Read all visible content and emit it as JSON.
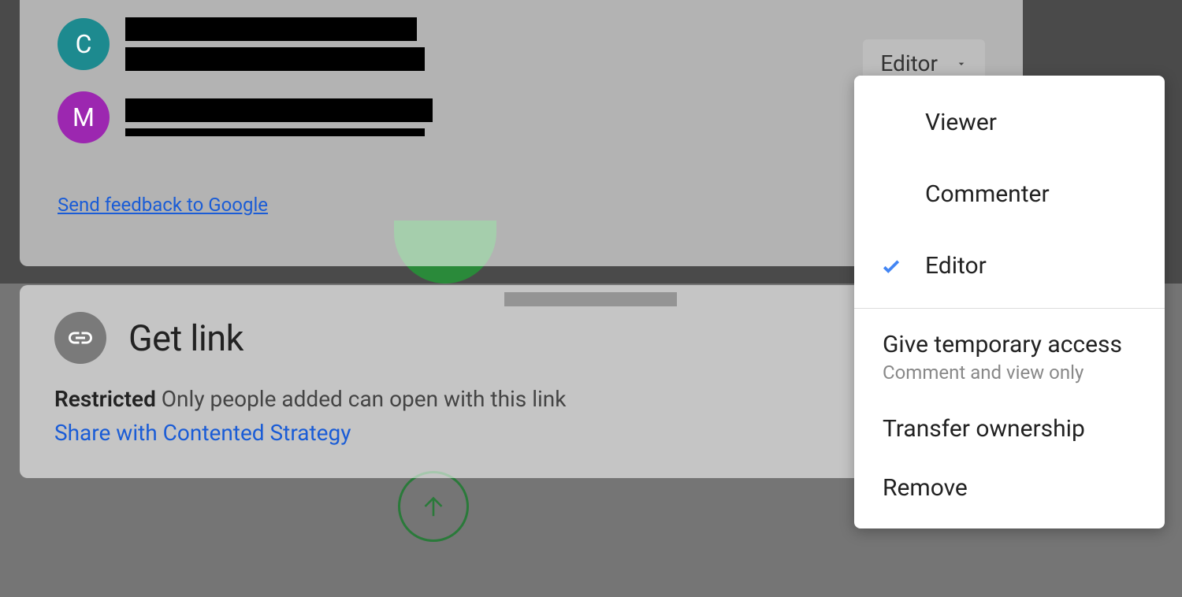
{
  "people": [
    {
      "initial": "C",
      "avatar_class": "avatar-c"
    },
    {
      "initial": "M",
      "avatar_class": "avatar-m"
    }
  ],
  "role_button": {
    "label": "Editor"
  },
  "feedback_link": "Send feedback to Google",
  "getlink": {
    "title": "Get link",
    "restricted_bold": "Restricted",
    "restricted_text": "Only people added can open with this link",
    "share_link": "Share with Contented Strategy"
  },
  "menu": {
    "viewer": "Viewer",
    "commenter": "Commenter",
    "editor": "Editor",
    "temp_access": "Give temporary access",
    "temp_sub": "Comment and view only",
    "transfer": "Transfer ownership",
    "remove": "Remove"
  }
}
